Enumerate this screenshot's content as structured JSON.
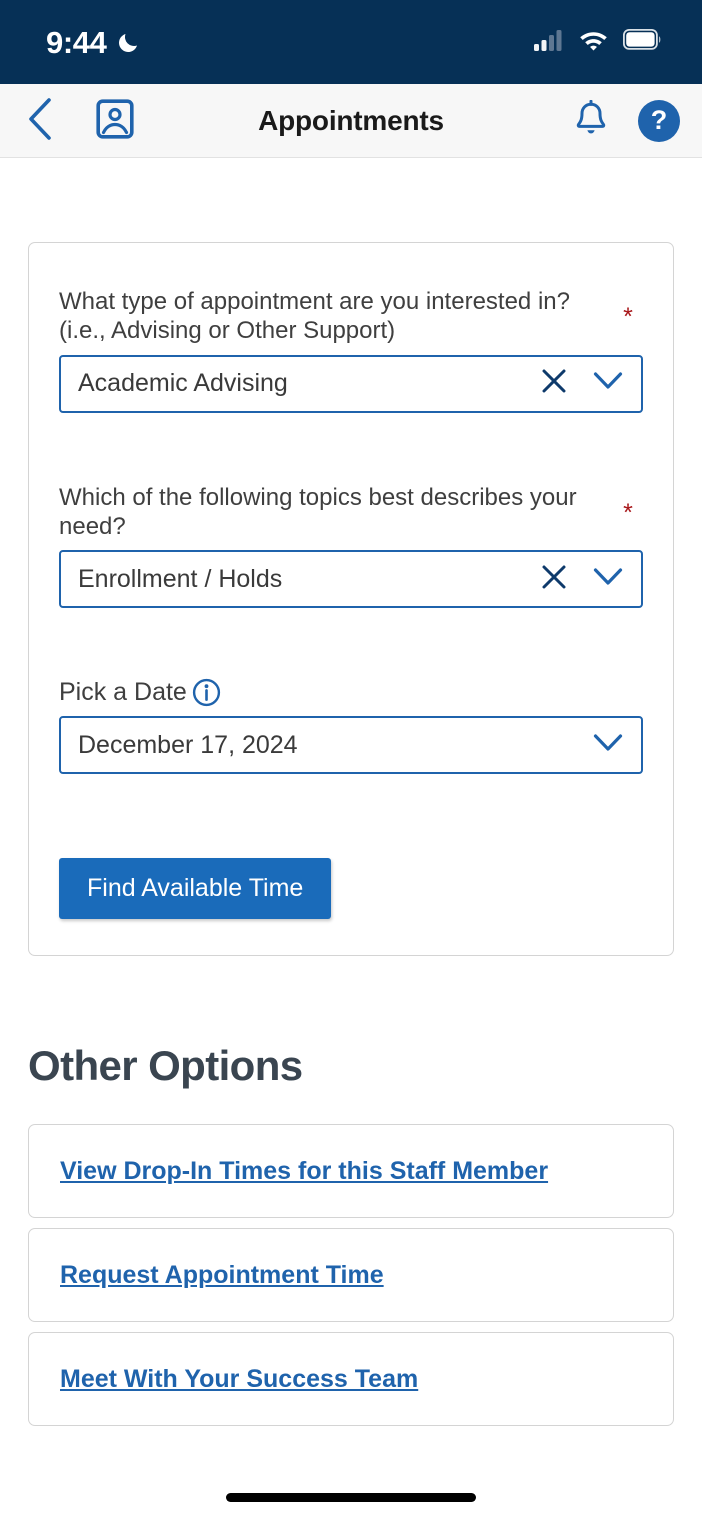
{
  "status_bar": {
    "time": "9:44",
    "moon_icon": "moon-crescent-icon",
    "cellular_icon": "cellular-signal-icon",
    "wifi_icon": "wifi-icon",
    "battery_icon": "battery-full-icon",
    "background_color": "#063056"
  },
  "nav_bar": {
    "back_icon": "chevron-left-icon",
    "profile_icon": "contact-card-icon",
    "title": "Appointments",
    "notifications_icon": "bell-icon",
    "help_label": "?",
    "help_icon": "question-mark-circle-icon",
    "accent_color": "#1F63AC"
  },
  "form": {
    "fields": [
      {
        "label": "What type of appointment are you interested in? (i.e., Advising or Other Support)",
        "required_marker": "*",
        "value": "Academic Advising",
        "clear_icon": "close-x-icon",
        "chevron_icon": "chevron-down-icon"
      },
      {
        "label": "Which of the following topics best describes your need?",
        "required_marker": "*",
        "value": "Enrollment / Holds",
        "clear_icon": "close-x-icon",
        "chevron_icon": "chevron-down-icon"
      }
    ],
    "date_field": {
      "label": "Pick a Date",
      "info_icon": "info-circle-icon",
      "value": "December 17, 2024",
      "chevron_icon": "chevron-down-icon"
    },
    "submit_label": "Find Available Time",
    "submit_color": "#1A6BBA",
    "required_color": "#A8171A"
  },
  "other_options": {
    "title": "Other Options",
    "links": [
      "View Drop-In Times for this Staff Member",
      "Request Appointment Time",
      "Meet With Your Success Team"
    ],
    "link_color": "#1F63AC"
  }
}
